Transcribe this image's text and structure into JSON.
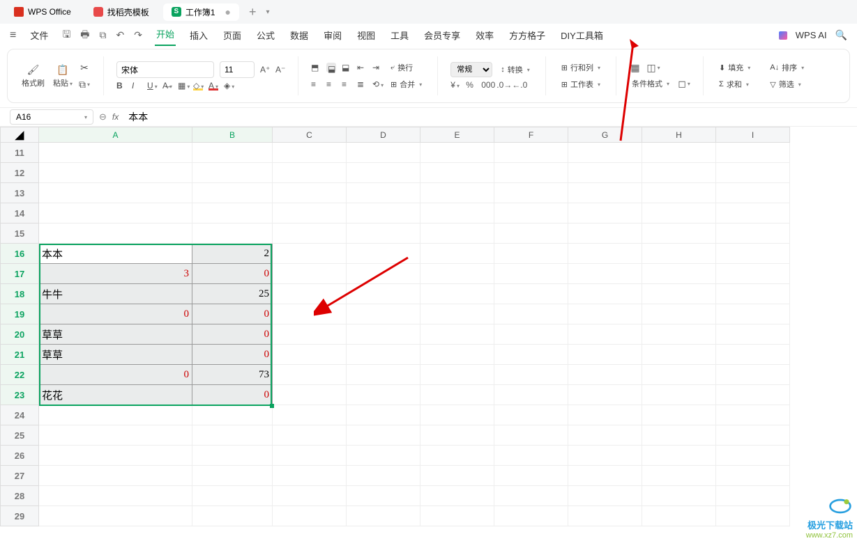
{
  "titlebar": {
    "app_name": "WPS Office",
    "tabs": [
      {
        "icon": "docer",
        "label": "找稻壳模板"
      },
      {
        "icon": "sheet",
        "label": "工作簿1",
        "dirty": "●"
      }
    ],
    "add": "+"
  },
  "menubar": {
    "file": "文件",
    "items": [
      "开始",
      "插入",
      "页面",
      "公式",
      "数据",
      "审阅",
      "视图",
      "工具",
      "会员专享",
      "效率",
      "方方格子",
      "DIY工具箱"
    ],
    "ai": "WPS AI"
  },
  "ribbon": {
    "format_painter": "格式刷",
    "paste": "粘贴",
    "font_name": "宋体",
    "font_size": "11",
    "wrap": "换行",
    "merge": "合并",
    "number_format": "常规",
    "convert": "转换",
    "rowcol": "行和列",
    "worksheet": "工作表",
    "cond_format": "条件格式",
    "fill": "填充",
    "sort": "排序",
    "sum": "求和",
    "filter": "筛选"
  },
  "formula_bar": {
    "name_box": "A16",
    "fx": "fx",
    "value": "本本"
  },
  "grid": {
    "columns": [
      "A",
      "B",
      "C",
      "D",
      "E",
      "F",
      "G",
      "H",
      "I"
    ],
    "selected_cols": [
      "A",
      "B"
    ],
    "row_start": 11,
    "row_end": 29,
    "selected_rows": [
      16,
      17,
      18,
      19,
      20,
      21,
      22,
      23
    ],
    "data": {
      "16": {
        "A": "本本",
        "B": "2"
      },
      "17": {
        "A": "3",
        "B": "0",
        "A_red": true,
        "B_red": true,
        "A_right": true
      },
      "18": {
        "A": "牛牛",
        "B": "25"
      },
      "19": {
        "A": "0",
        "B": "0",
        "A_red": true,
        "B_red": true,
        "A_right": true
      },
      "20": {
        "A": "草草",
        "B": "0",
        "B_red": true
      },
      "21": {
        "A": "草草",
        "B": "0",
        "B_red": true
      },
      "22": {
        "A": "0",
        "B": "73",
        "A_red": true,
        "A_right": true
      },
      "23": {
        "A": "花花",
        "B": "0",
        "B_red": true
      }
    }
  },
  "watermark": {
    "line1": "极光下载站",
    "line2": "www.xz7.com"
  }
}
